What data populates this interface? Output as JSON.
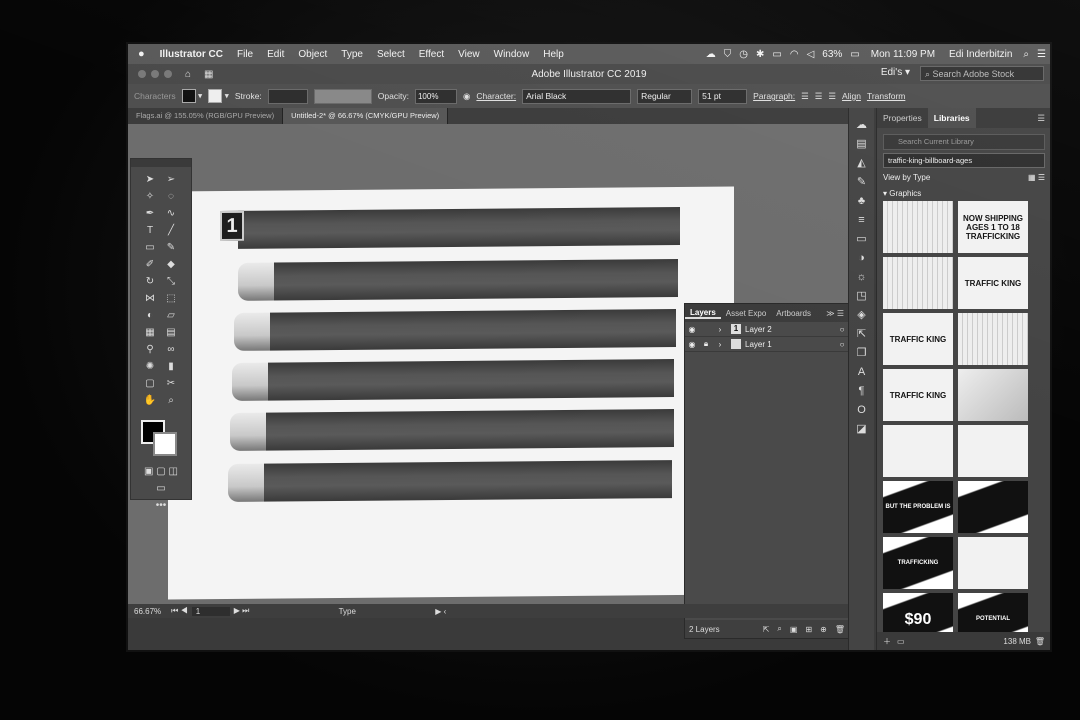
{
  "menubar": {
    "apple": "",
    "app": "Illustrator CC",
    "items": [
      "File",
      "Edit",
      "Object",
      "Type",
      "Select",
      "Effect",
      "View",
      "Window",
      "Help"
    ],
    "battery": "63%",
    "clock": "Mon 11:09 PM",
    "user": "Edi Inderbitzin"
  },
  "titlebar": {
    "title": "Adobe Illustrator CC 2019",
    "workspace": "Edi's ▾",
    "search_placeholder": "Search Adobe Stock"
  },
  "control": {
    "label": "Characters",
    "stroke": "Stroke:",
    "opacity_label": "Opacity:",
    "opacity": "100%",
    "character": "Character:",
    "font": "Arial Black",
    "style": "Regular",
    "size": "51 pt",
    "paragraph": "Paragraph:",
    "align": "Align",
    "transform": "Transform"
  },
  "tabs": [
    {
      "label": "Flags.ai @ 155.05% (RGB/GPU Preview)"
    },
    {
      "label": "Untitled-2* @ 66.67% (CMYK/GPU Preview)"
    }
  ],
  "artboard": {
    "badge": "1"
  },
  "layers_panel": {
    "tabs": [
      "Layers",
      "Asset Expo",
      "Artboards"
    ],
    "rows": [
      {
        "name": "Layer 2",
        "thumb": "1"
      },
      {
        "name": "Layer 1",
        "thumb": ""
      }
    ],
    "count": "2 Layers"
  },
  "status": {
    "zoom": "66.67%",
    "page": "1",
    "tool": "Type"
  },
  "libraries": {
    "tabs": [
      "Properties",
      "Libraries"
    ],
    "search_placeholder": "Search Current Library",
    "library": "traffic-king-billboard-ages",
    "view_by": "View by Type",
    "section": "Graphics",
    "tiles": [
      {
        "text": "",
        "style": "lines"
      },
      {
        "text": "NOW SHIPPING AGES 1 TO 18 TRAFFICKING",
        "style": "plain"
      },
      {
        "text": "",
        "style": "lines"
      },
      {
        "text": "TRAFFIC KING",
        "style": "plain"
      },
      {
        "text": "TRAFFIC KING",
        "style": "plain"
      },
      {
        "text": "",
        "style": "lines"
      },
      {
        "text": "TRAFFIC KING",
        "style": "plain"
      },
      {
        "text": "",
        "style": "gray"
      },
      {
        "text": "",
        "style": "plain"
      },
      {
        "text": "",
        "style": "plain"
      },
      {
        "text": "BUT THE PROBLEM IS",
        "style": "dark"
      },
      {
        "text": "",
        "style": "dark"
      },
      {
        "text": "TRAFFICKING",
        "style": "dark"
      },
      {
        "text": "",
        "style": "plain"
      },
      {
        "text": "$90",
        "style": "dark"
      },
      {
        "text": "POTENTIAL",
        "style": "dark"
      }
    ],
    "storage": "138 MB"
  }
}
